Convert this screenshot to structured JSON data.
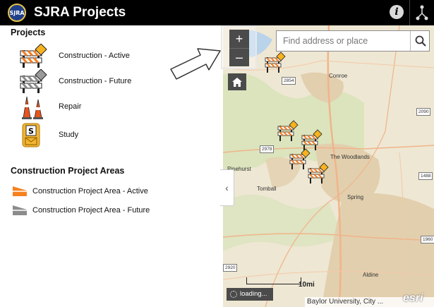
{
  "header": {
    "logo_text": "SJRA",
    "title": "SJRA Projects",
    "about_icon": "info-icon",
    "share_icon": "share-icon",
    "background": "#000000"
  },
  "legend": {
    "projects_title": "Projects",
    "projects": [
      {
        "label": "Construction - Active",
        "icon": "construction-active-icon",
        "accent": "#f5a623"
      },
      {
        "label": "Construction - Future",
        "icon": "construction-future-icon",
        "accent": "#8a8a8a"
      },
      {
        "label": "Repair",
        "icon": "traffic-cones-icon",
        "accent": "#e8541e"
      },
      {
        "label": "Study",
        "icon": "study-envelope-icon",
        "accent": "#f2b632"
      }
    ],
    "areas_title": "Construction Project Areas",
    "areas": [
      {
        "label": "Construction Project Area - Active",
        "icon": "area-active-icon",
        "color": "#f5821f"
      },
      {
        "label": "Construction Project Area - Future",
        "icon": "area-future-icon",
        "color": "#8c8c8c"
      }
    ]
  },
  "map": {
    "zoom_in": "+",
    "zoom_out": "–",
    "home_icon": "home-icon",
    "search_placeholder": "Find address or place",
    "search_icon": "search-icon",
    "scale_label": "10mi",
    "loading_text": "loading...",
    "attribution": "Baylor University, City ...",
    "esri_logo": "esri",
    "towns": [
      "Conroe",
      "Pinehurst",
      "The Woodlands",
      "Tomball",
      "Spring",
      "Aldine"
    ],
    "highways": [
      "2854",
      "2978",
      "2090",
      "1488",
      "1960",
      "2920"
    ],
    "collapse_icon": "chevron-left-icon",
    "colors": {
      "land": "#eee7d3",
      "urban": "#e2cfae",
      "forest": "#d6e3b8",
      "water": "#b9d3ea",
      "road": "#f0b48a"
    }
  }
}
